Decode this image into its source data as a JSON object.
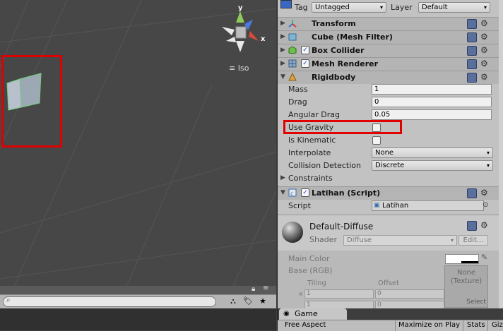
{
  "inspector": {
    "tag_label": "Tag",
    "tag_value": "Untagged",
    "layer_label": "Layer",
    "layer_value": "Default",
    "components": {
      "transform": "Transform",
      "mesh_filter": "Cube (Mesh Filter)",
      "box_collider": "Box Collider",
      "mesh_renderer": "Mesh Renderer",
      "rigidbody": "Rigidbody",
      "script": "Latihan (Script)"
    },
    "rigidbody": {
      "mass_label": "Mass",
      "mass_value": "1",
      "drag_label": "Drag",
      "drag_value": "0",
      "angular_drag_label": "Angular Drag",
      "angular_drag_value": "0.05",
      "use_gravity_label": "Use Gravity",
      "use_gravity_checked": false,
      "is_kinematic_label": "Is Kinematic",
      "is_kinematic_checked": false,
      "interpolate_label": "Interpolate",
      "interpolate_value": "None",
      "collision_label": "Collision Detection",
      "collision_value": "Discrete",
      "constraints_label": "Constraints"
    },
    "script": {
      "label": "Script",
      "value": "Latihan"
    },
    "material": {
      "name": "Default-Diffuse",
      "shader_label": "Shader",
      "shader_value": "Diffuse",
      "edit_label": "Edit...",
      "main_color_label": "Main Color",
      "base_label": "Base (RGB)",
      "tiling_label": "Tiling",
      "offset_label": "Offset",
      "x_label": "x",
      "tiling_x": "1",
      "offset_x": "0",
      "tiling_y": "1",
      "offset_y": "0",
      "texture_none": "None",
      "texture_type": "(Texture)",
      "select_label": "Select"
    }
  },
  "scene": {
    "iso_label": "Iso",
    "gizmo_axes": {
      "y": "y",
      "x": "x"
    },
    "highlight_color": "#e00000"
  },
  "game": {
    "tab_label": "Game",
    "aspect": "Free Aspect",
    "maximize": "Maximize on Play",
    "stats": "Stats",
    "gizmos": "Giz"
  }
}
